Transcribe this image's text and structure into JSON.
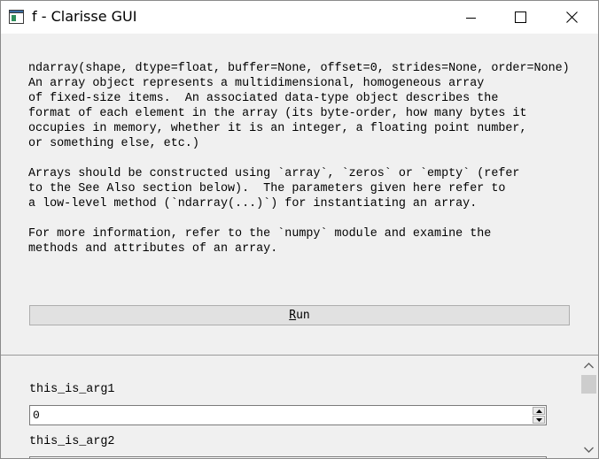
{
  "window": {
    "title": "f - Clarisse GUI",
    "icon": "window-app-icon"
  },
  "titlebar_buttons": {
    "minimize_icon": "minimize-icon",
    "maximize_icon": "maximize-icon",
    "close_icon": "close-icon"
  },
  "doc": {
    "text": "ndarray(shape, dtype=float, buffer=None, offset=0, strides=None, order=None)\nAn array object represents a multidimensional, homogeneous array\nof fixed-size items.  An associated data-type object describes the\nformat of each element in the array (its byte-order, how many bytes it\noccupies in memory, whether it is an integer, a floating point number,\nor something else, etc.)\n\nArrays should be constructed using `array`, `zeros` or `empty` (refer\nto the See Also section below).  The parameters given here refer to\na low-level method (`ndarray(...)`) for instantiating an array.\n\nFor more information, refer to the `numpy` module and examine the\nmethods and attributes of an array."
  },
  "run_button": {
    "mnemonic": "R",
    "rest": "un"
  },
  "args": [
    {
      "label": "this_is_arg1",
      "value": "0"
    },
    {
      "label": "this_is_arg2",
      "value": ""
    }
  ],
  "colors": {
    "titlebar_bg": "#ffffff",
    "window_bg": "#f0f0f0",
    "button_bg": "#e1e1e1",
    "scroll_thumb": "#cdcdcd"
  }
}
